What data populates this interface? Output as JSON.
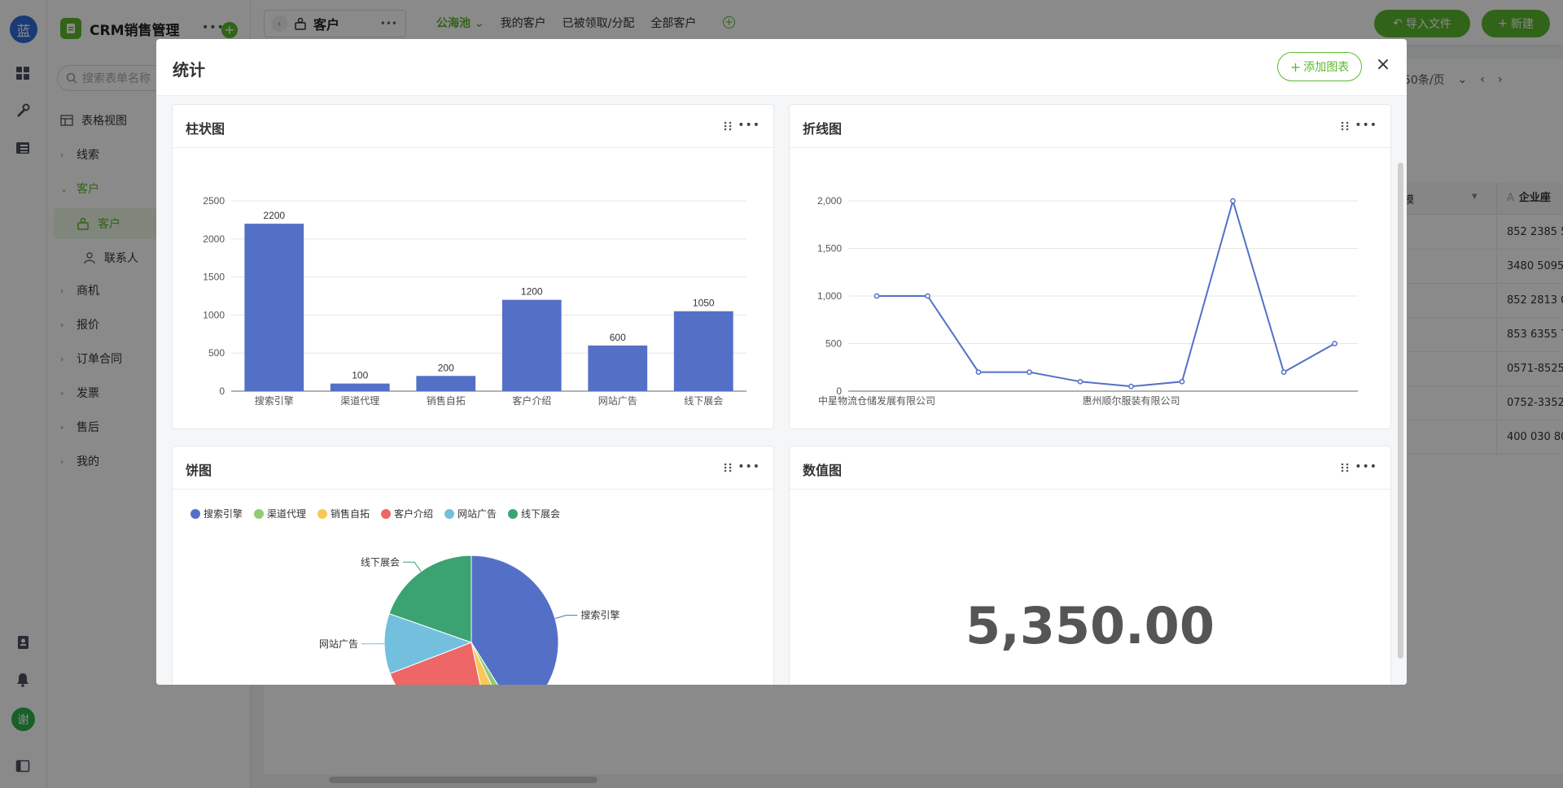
{
  "app": {
    "logo_text": "蓝",
    "title": "CRM销售管理",
    "search_placeholder": "搜索表单名称",
    "user_avatar": "谢",
    "nav": [
      {
        "label": "表格视图",
        "kind": "view"
      },
      {
        "label": "线索",
        "kind": "folder"
      },
      {
        "label": "客户",
        "kind": "folder-open"
      },
      {
        "label": "客户",
        "kind": "child-active"
      },
      {
        "label": "联系人",
        "kind": "child"
      },
      {
        "label": "商机",
        "kind": "folder"
      },
      {
        "label": "报价",
        "kind": "folder"
      },
      {
        "label": "订单合同",
        "kind": "folder"
      },
      {
        "label": "发票",
        "kind": "folder"
      },
      {
        "label": "售后",
        "kind": "folder"
      },
      {
        "label": "我的",
        "kind": "folder"
      }
    ]
  },
  "topbar": {
    "tab_label": "客户",
    "views": [
      "公海池",
      "我的客户",
      "已被领取/分配",
      "全部客户"
    ],
    "import_label": "导入文件",
    "new_label": "新建",
    "page_size": "50条/页"
  },
  "grid": {
    "header_partial": "模",
    "header_col": "企业座",
    "cells": [
      "852 2385 5",
      "3480 5095",
      "852 2813 0",
      "853 6355 7",
      "0571-8525",
      "0752-3352",
      "400 030 80"
    ]
  },
  "modal": {
    "title": "统计",
    "add_chart_label": "添加图表",
    "close_glyph": "×"
  },
  "cards": {
    "bar_title": "柱状图",
    "line_title": "折线图",
    "pie_title": "饼图",
    "number_title": "数值图",
    "number_value": "5,350.00"
  },
  "colors": {
    "accent": "#5cb82e",
    "bar": "#5470c6",
    "pie": [
      "#5470c6",
      "#91cc75",
      "#fac858",
      "#ee6666",
      "#73c0de",
      "#3ba272"
    ]
  },
  "icons": {
    "rail": [
      "grid-icon",
      "tools-icon",
      "table-icon",
      "contacts-icon",
      "bell-icon",
      "sidebar-toggle-icon"
    ],
    "drag": "drag-handle-icon",
    "more": "more-icon"
  },
  "chart_data": [
    {
      "type": "bar",
      "categories": [
        "搜索引擎",
        "渠道代理",
        "销售自拓",
        "客户介绍",
        "网站广告",
        "线下展会"
      ],
      "values": [
        2200,
        100,
        200,
        1200,
        600,
        1050
      ],
      "ylim": [
        0,
        2500
      ],
      "yticks": [
        0,
        500,
        1000,
        1500,
        2000,
        2500
      ],
      "data_labels": true
    },
    {
      "type": "line",
      "x": [
        "p1",
        "p2",
        "p3",
        "p4",
        "p5",
        "p6",
        "p7",
        "p8",
        "p9",
        "p10"
      ],
      "x_tick_labels": [
        {
          "index": 0,
          "label": "中星物流仓储发展有限公司"
        },
        {
          "index": 5,
          "label": "惠州顺尔服装有限公司"
        }
      ],
      "values": [
        1000,
        1000,
        200,
        200,
        100,
        50,
        100,
        2000,
        200,
        500
      ],
      "ylim": [
        0,
        2000
      ],
      "yticks": [
        "0",
        "500",
        "1,000",
        "1,500",
        "2,000"
      ]
    },
    {
      "type": "pie",
      "legend": [
        "搜索引擎",
        "渠道代理",
        "销售自拓",
        "客户介绍",
        "网站广告",
        "线下展会"
      ],
      "values": [
        2200,
        100,
        200,
        1200,
        600,
        1050
      ],
      "legend_position": "top-left",
      "visible_slice_labels": [
        "搜索引擎",
        "线下展会",
        "网站广告"
      ]
    }
  ]
}
